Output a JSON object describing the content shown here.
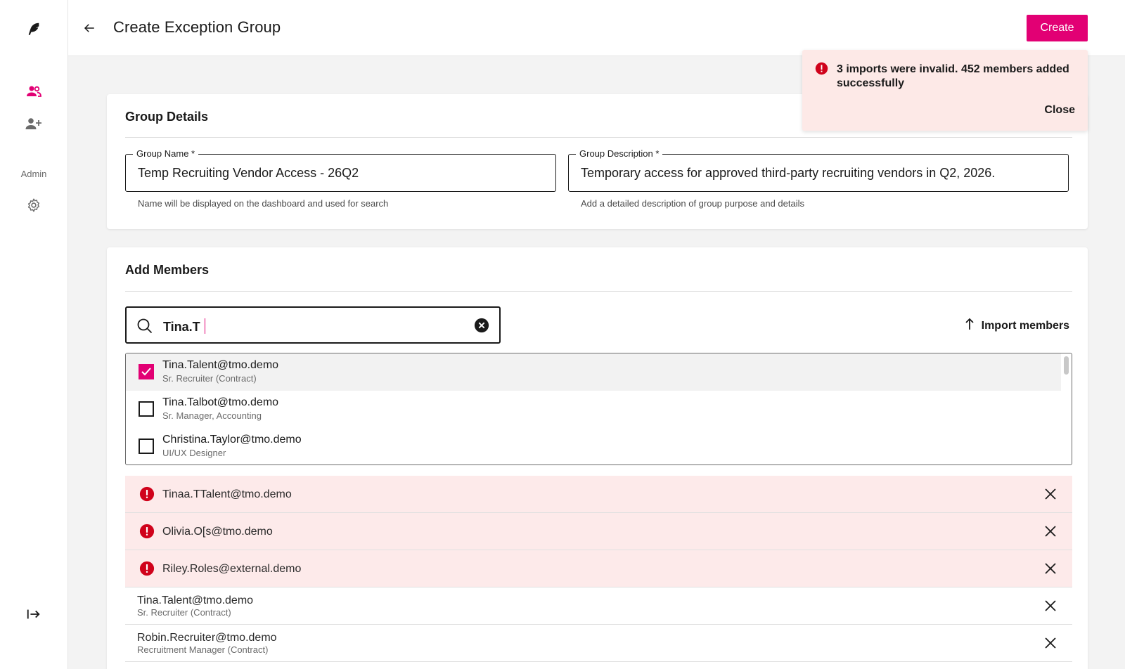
{
  "header": {
    "title": "Create Exception Group",
    "create_label": "Create"
  },
  "sidebar": {
    "admin_label": "Admin"
  },
  "toast": {
    "message": "3 imports were invalid. 452 members added successfully",
    "close_label": "Close"
  },
  "group_details": {
    "title": "Group Details",
    "name": {
      "label": "Group Name *",
      "value": "Temp Recruiting Vendor Access - 26Q2",
      "help": "Name will be displayed on the dashboard and used for search"
    },
    "description": {
      "label": "Group Description *",
      "value": "Temporary access for approved third-party recruiting vendors in Q2, 2026.",
      "help": "Add a detailed description of group purpose and details"
    }
  },
  "add_members": {
    "title": "Add Members",
    "search_value": "Tina.T",
    "import_label": "Import members",
    "results": [
      {
        "email": "Tina.Talent@tmo.demo",
        "role": "Sr. Recruiter (Contract)",
        "checked": true
      },
      {
        "email": "Tina.Talbot@tmo.demo",
        "role": "Sr. Manager, Accounting",
        "checked": false
      },
      {
        "email": "Christina.Taylor@tmo.demo",
        "role": "UI/UX Designer",
        "checked": false
      }
    ],
    "invalid_members": [
      {
        "email": "Tinaa.TTalent@tmo.demo"
      },
      {
        "email": "Olivia.O[s@tmo.demo"
      },
      {
        "email": "Riley.Roles@external.demo"
      }
    ],
    "members": [
      {
        "email": "Tina.Talent@tmo.demo",
        "role": "Sr. Recruiter (Contract)"
      },
      {
        "email": "Robin.Recruiter@tmo.demo",
        "role": "Recruitment Manager (Contract)"
      }
    ]
  },
  "colors": {
    "brand": "#e20074",
    "error": "#d0021b",
    "error_bg": "#fdeaea"
  }
}
